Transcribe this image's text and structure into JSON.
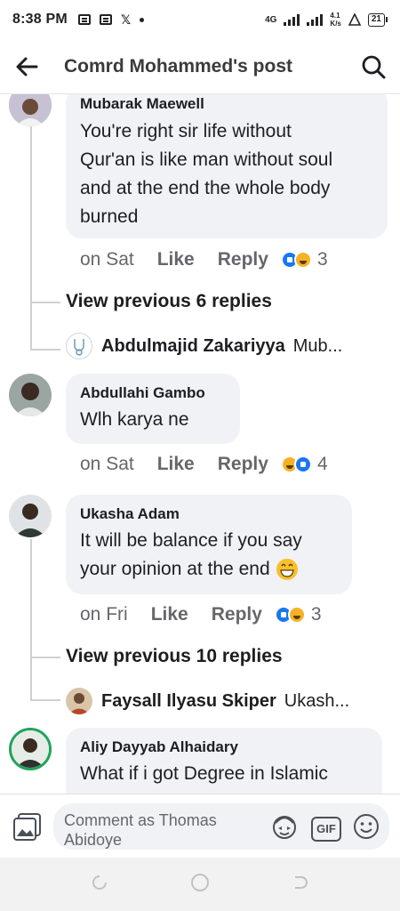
{
  "status_bar": {
    "time": "8:38 PM",
    "network": "4G",
    "speed_value": "4.1",
    "speed_unit": "K/s",
    "battery": "21"
  },
  "header": {
    "title": "Comrd Mohammed's post"
  },
  "comments": [
    {
      "name": "Mubarak Maewell",
      "text_lines": [
        "You're right sir life without",
        "Qur'an is like man without soul",
        "and at the end the whole body",
        "burned"
      ],
      "time": "on Sat",
      "like": "Like",
      "reply": "Reply",
      "reaction_count": "3"
    },
    {
      "name": "Abdullahi Gambo",
      "text_lines": [
        "Wlh karya ne"
      ],
      "time": "on Sat",
      "like": "Like",
      "reply": "Reply",
      "reaction_count": "4"
    },
    {
      "name": "Ukasha Adam",
      "text_lines": [
        "It will be balance if you say",
        "your opinion at the end"
      ],
      "time": "on Fri",
      "like": "Like",
      "reply": "Reply",
      "reaction_count": "3"
    },
    {
      "name": "Aliy Dayyab Alhaidary",
      "text_lines": [
        "What if i got Degree in Islamic"
      ]
    }
  ],
  "reply_threads": [
    {
      "view_previous": "View previous 6 replies",
      "preview_name": "Abdulmajid Zakariyya",
      "preview_text": "Mub..."
    },
    {
      "view_previous": "View previous 10 replies",
      "preview_name": "Faysall Ilyasu Skiper",
      "preview_text": "Ukash..."
    }
  ],
  "composer": {
    "placeholder_line1": "Comment as Thomas",
    "placeholder_line2": "Abidoye",
    "gif_label": "GIF"
  },
  "icons": [
    "back-arrow-icon",
    "search-icon",
    "photo-icon",
    "avatar-sticker-icon",
    "gif-icon",
    "emoji-icon"
  ],
  "colors": {
    "bubble": "#f0f2f5",
    "meta": "#65676b",
    "like_blue": "#1877f2",
    "haha_yellow": "#f7b125"
  }
}
